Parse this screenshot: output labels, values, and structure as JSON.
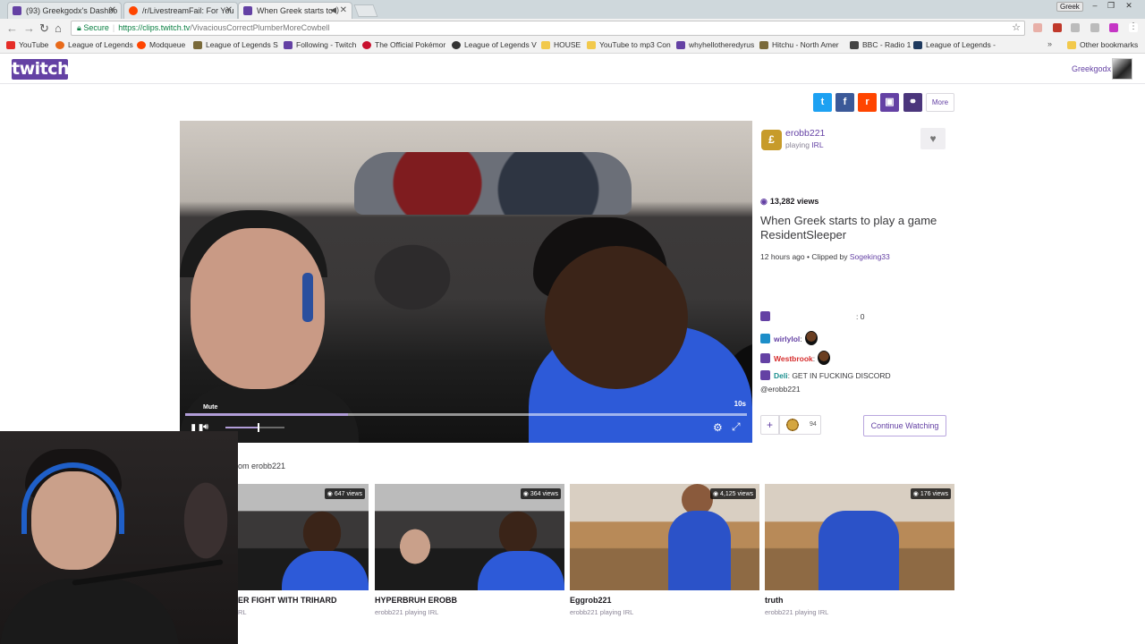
{
  "browser": {
    "tabs": [
      {
        "label": "(93) Greekgodx's Dashbo",
        "color": "#6441a4"
      },
      {
        "label": "/r/LivestreamFail: For You",
        "color": "#ff4500"
      },
      {
        "label": "When Greek starts to",
        "color": "#6441a4"
      }
    ],
    "profile_user": "Greek",
    "url_secure_label": "Secure",
    "url_host": "https://clips.twitch.tv",
    "url_path": "/VivaciousCorrectPlumberMoreCowbell",
    "bookmarks": [
      {
        "label": "YouTube",
        "color": "#e52d27"
      },
      {
        "label": "League of Legends",
        "color": "#e86a1a"
      },
      {
        "label": "Modqueue",
        "color": "#ff4500"
      },
      {
        "label": "League of Legends S",
        "color": "#7a6a3a"
      },
      {
        "label": "Following - Twitch",
        "color": "#6441a4"
      },
      {
        "label": "The Official Pokémor",
        "color": "#c8102e"
      },
      {
        "label": "League of Legends V",
        "color": "#333333"
      },
      {
        "label": "HOUSE",
        "color": "#f2c94c"
      },
      {
        "label": "YouTube to mp3 Con",
        "color": "#f2c94c"
      },
      {
        "label": "whyhellotheredyrus",
        "color": "#6441a4"
      },
      {
        "label": "Hitchu - North Amer",
        "color": "#7a6a3a"
      },
      {
        "label": "BBC - Radio 1",
        "color": "#444444"
      },
      {
        "label": "League of Legends -",
        "color": "#1e3a5f"
      }
    ],
    "other_bookmarks": "Other bookmarks"
  },
  "twitch": {
    "logo": "twitch",
    "username": "Greekgodx",
    "share_more": "More",
    "share_buttons": [
      {
        "name": "twitter",
        "glyph": "t",
        "color": "#1da1f2"
      },
      {
        "name": "facebook",
        "glyph": "f",
        "color": "#3b5998"
      },
      {
        "name": "reddit",
        "glyph": "r",
        "color": "#ff4500"
      },
      {
        "name": "twitch",
        "glyph": "▣",
        "color": "#6441a4"
      },
      {
        "name": "link",
        "glyph": "⚭",
        "color": "#4b367c"
      }
    ]
  },
  "player": {
    "time_remaining": "10s",
    "mute_tooltip": "Mute",
    "progress": 0.29,
    "volume": 0.55
  },
  "clip": {
    "broadcaster": "erobb221",
    "playing_prefix": "playing ",
    "game": "IRL",
    "views": "13,282 views",
    "title": "When Greek starts to play a game ResidentSleeper",
    "time_ago": "12 hours ago",
    "clipped_by_prefix": " • Clipped by ",
    "clipped_by": "Sogeking33",
    "continue_watching": "Continue Watching",
    "bits_count": "94"
  },
  "chat": [
    {
      "user": "",
      "color": "#6441a4",
      "message": ": 0",
      "badge": "purple",
      "emote": false
    },
    {
      "user": "wirlylol",
      "color": "#6441a4",
      "message": ":",
      "badge": "blue",
      "emote": true
    },
    {
      "user": "Westbrook",
      "color": "#d62e2e",
      "message": ":",
      "badge": "purple",
      "emote": true
    },
    {
      "user": "Deli",
      "color": "#1a8e8e",
      "message": ": GET IN FUCKING DISCORD",
      "badge": "purple",
      "emote": false
    }
  ],
  "chat_trailing": "@erobb221",
  "more_clips": {
    "heading": "om erobb221",
    "items": [
      {
        "title": "ER FIGHT WITH TRIHARD",
        "sub": "RL",
        "views": "647 views",
        "scene": "room"
      },
      {
        "title": "HYPERBRUH EROBB",
        "sub": "erobb221 playing IRL",
        "views": "364 views",
        "scene": "room"
      },
      {
        "title": "Eggrob221",
        "sub": "erobb221 playing IRL",
        "views": "4,125 views",
        "scene": "kitchen"
      },
      {
        "title": "truth",
        "sub": "erobb221 playing IRL",
        "views": "176 views",
        "scene": "kitchen"
      }
    ]
  }
}
